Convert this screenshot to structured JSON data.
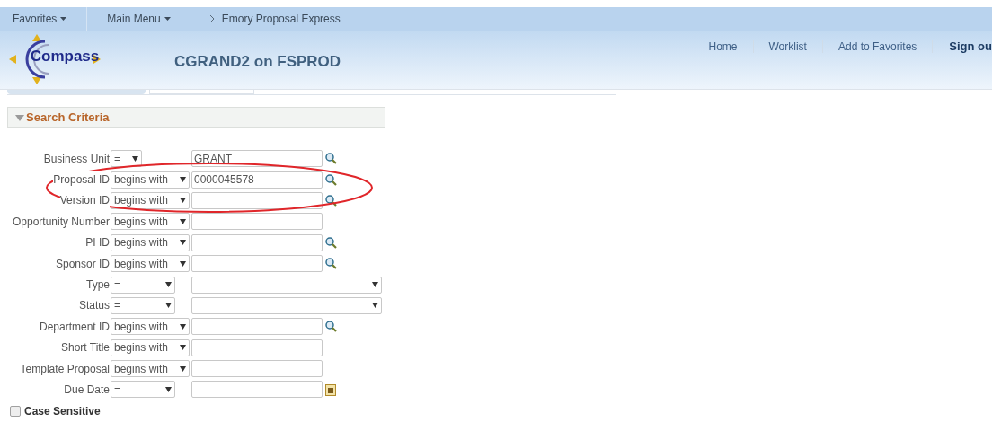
{
  "nav_bar": {
    "items": [
      {
        "label": "Favorites",
        "kind": "menu"
      },
      {
        "label": "Main Menu",
        "kind": "menu"
      },
      {
        "label": "Emory Proposal Express",
        "kind": "breadcrumb"
      }
    ]
  },
  "header": {
    "logo_text": "Compass",
    "title": "CGRAND2 on FSPROD",
    "links": [
      {
        "label": "Home",
        "bold": false
      },
      {
        "label": "Worklist",
        "bold": false
      },
      {
        "label": "Add to Favorites",
        "bold": false
      },
      {
        "label": "Sign ou",
        "bold": true
      }
    ]
  },
  "search_criteria": {
    "title": "Search Criteria",
    "expanded": true,
    "rows": [
      {
        "label": "Business Unit",
        "operator": "=",
        "value": "GRANT",
        "kind": "code"
      },
      {
        "label": "Proposal ID",
        "operator": "begins with",
        "value": "0000045578",
        "kind": "lookup"
      },
      {
        "label": "Version ID",
        "operator": "begins with",
        "kind": "lookup"
      },
      {
        "label": "Opportunity Number",
        "operator": "begins with",
        "kind": "plain"
      },
      {
        "label": "PI ID",
        "operator": "begins with",
        "kind": "lookup"
      },
      {
        "label": "Sponsor ID",
        "operator": "begins with",
        "kind": "lookup"
      },
      {
        "label": "Type",
        "operator": "=",
        "kind": "list"
      },
      {
        "label": "Status",
        "operator": "=",
        "kind": "list"
      },
      {
        "label": "Department ID",
        "operator": "begins with",
        "kind": "lookup"
      },
      {
        "label": "Short Title",
        "operator": "begins with",
        "kind": "plain"
      },
      {
        "label": "Template Proposal",
        "operator": "begins with",
        "kind": "plain"
      },
      {
        "label": "Due Date",
        "operator": "=",
        "kind": "date"
      }
    ],
    "case_sensitive": {
      "label": "Case Sensitive",
      "checked": false
    }
  },
  "annotation": {
    "kind": "ellipse"
  }
}
